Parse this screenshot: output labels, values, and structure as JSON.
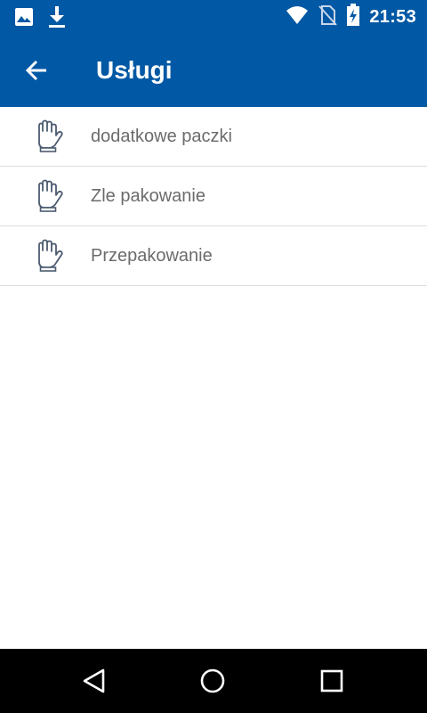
{
  "status_bar": {
    "time": "21:53",
    "icons": [
      "image-icon",
      "download-icon",
      "wifi-icon",
      "no-sim-icon",
      "battery-charging-icon"
    ]
  },
  "app_bar": {
    "title": "Usługi",
    "back_icon": "arrow-back-icon"
  },
  "services": [
    {
      "label": "dodatkowe paczki",
      "icon": "hand-icon"
    },
    {
      "label": "Zle pakowanie",
      "icon": "hand-icon"
    },
    {
      "label": "Przepakowanie",
      "icon": "hand-icon"
    }
  ],
  "nav_bar": {
    "buttons": [
      "back-triangle-icon",
      "home-circle-icon",
      "recents-square-icon"
    ]
  },
  "colors": {
    "primary": "#0158a4",
    "text_secondary": "#6b6b6b",
    "divider": "#dcdcdc",
    "nav_bar": "#000000"
  }
}
